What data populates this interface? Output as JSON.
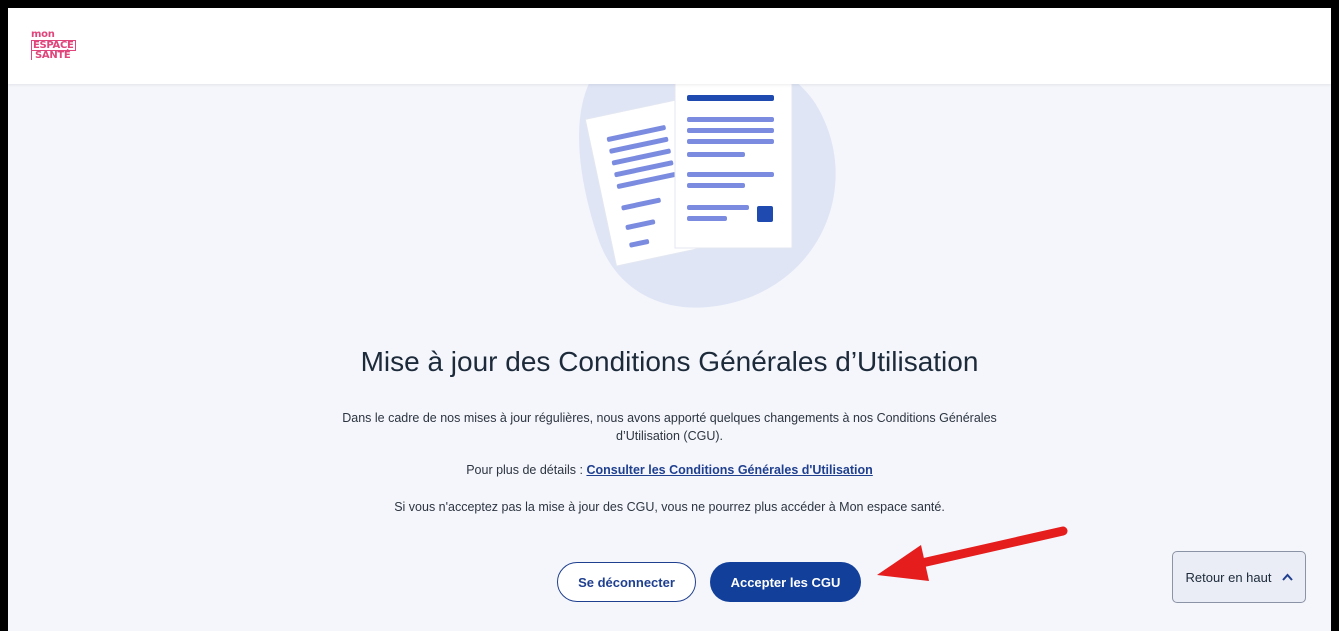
{
  "header": {
    "logo": {
      "line1": "mon",
      "line2": "ESPACE",
      "line3": "SANTÉ"
    }
  },
  "main": {
    "title": "Mise à jour des Conditions Générales d’Utilisation",
    "intro_line1": "Dans le cadre de nos mises à jour régulières, nous avons apporté quelques changements à nos Conditions Générales",
    "intro_line2": "d’Utilisation (CGU).",
    "details_prefix": "Pour plus de détails :",
    "details_link": "Consulter les Conditions Générales d'Utilisation",
    "warning": "Si vous n'acceptez pas la mise à jour des CGU, vous ne pourrez plus accéder à Mon espace santé."
  },
  "actions": {
    "logout_label": "Se déconnecter",
    "accept_label": "Accepter les CGU"
  },
  "back_to_top": {
    "label": "Retour en haut",
    "icon": "chevron-up-icon"
  },
  "colors": {
    "brand_pink": "#e0457b",
    "primary_blue": "#123f9a",
    "link_blue": "#1f3f8f",
    "annotation_red": "#e51d1d"
  }
}
